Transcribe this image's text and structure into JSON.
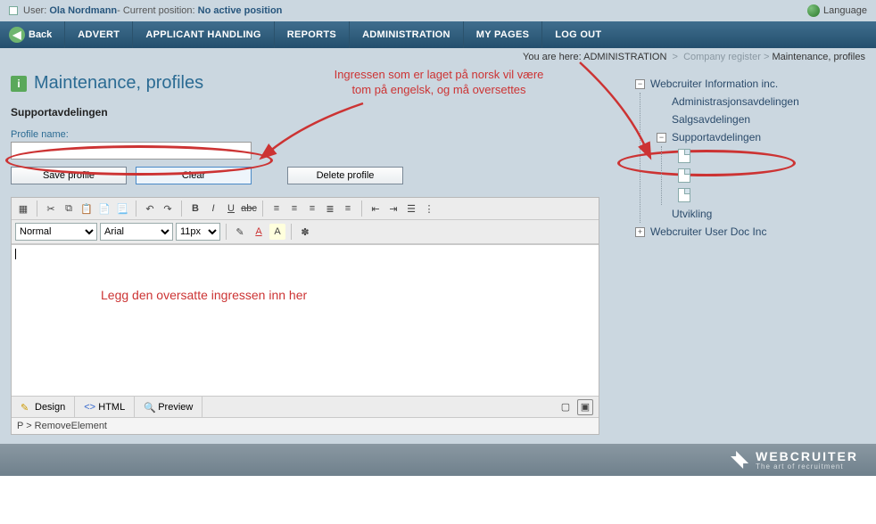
{
  "topbar": {
    "user_label": "User:",
    "user_name": "Ola Nordmann",
    "position_label": " - Current position:",
    "position_value": "No active position",
    "language_label": "Language"
  },
  "menu": {
    "back": "Back",
    "items": [
      "ADVERT",
      "APPLICANT HANDLING",
      "REPORTS",
      "ADMINISTRATION",
      "MY PAGES",
      "LOG OUT"
    ]
  },
  "breadcrumb": {
    "prefix": "You are here:",
    "parts": [
      "ADMINISTRATION",
      "Company register",
      "Maintenance, profiles"
    ]
  },
  "page": {
    "title": "Maintenance, profiles",
    "section": "Supportavdelingen",
    "profile_name_label": "Profile name:",
    "profile_name_value": "",
    "buttons": {
      "save": "Save profile",
      "clear": "Clear",
      "delete": "Delete profile"
    }
  },
  "editor": {
    "format": "Normal",
    "font": "Arial",
    "size": "11px",
    "canvas_note": "Legg den oversatte ingressen inn her",
    "tabs": {
      "design": "Design",
      "html": "HTML",
      "preview": "Preview"
    },
    "status": "P > RemoveElement"
  },
  "tree": {
    "root1": "Webcruiter Information inc.",
    "c1": "Administrasjonsavdelingen",
    "c2": "Salgsavdelingen",
    "c3": "Supportavdelingen",
    "c4": "Utvikling",
    "root2": "Webcruiter User Doc Inc"
  },
  "annotations": {
    "a1": "Ingressen som er laget på norsk vil være\ntom på engelsk, og må oversettes"
  },
  "footer": {
    "brand": "WEBCRUITER",
    "tagline": "The art of recruitment"
  }
}
